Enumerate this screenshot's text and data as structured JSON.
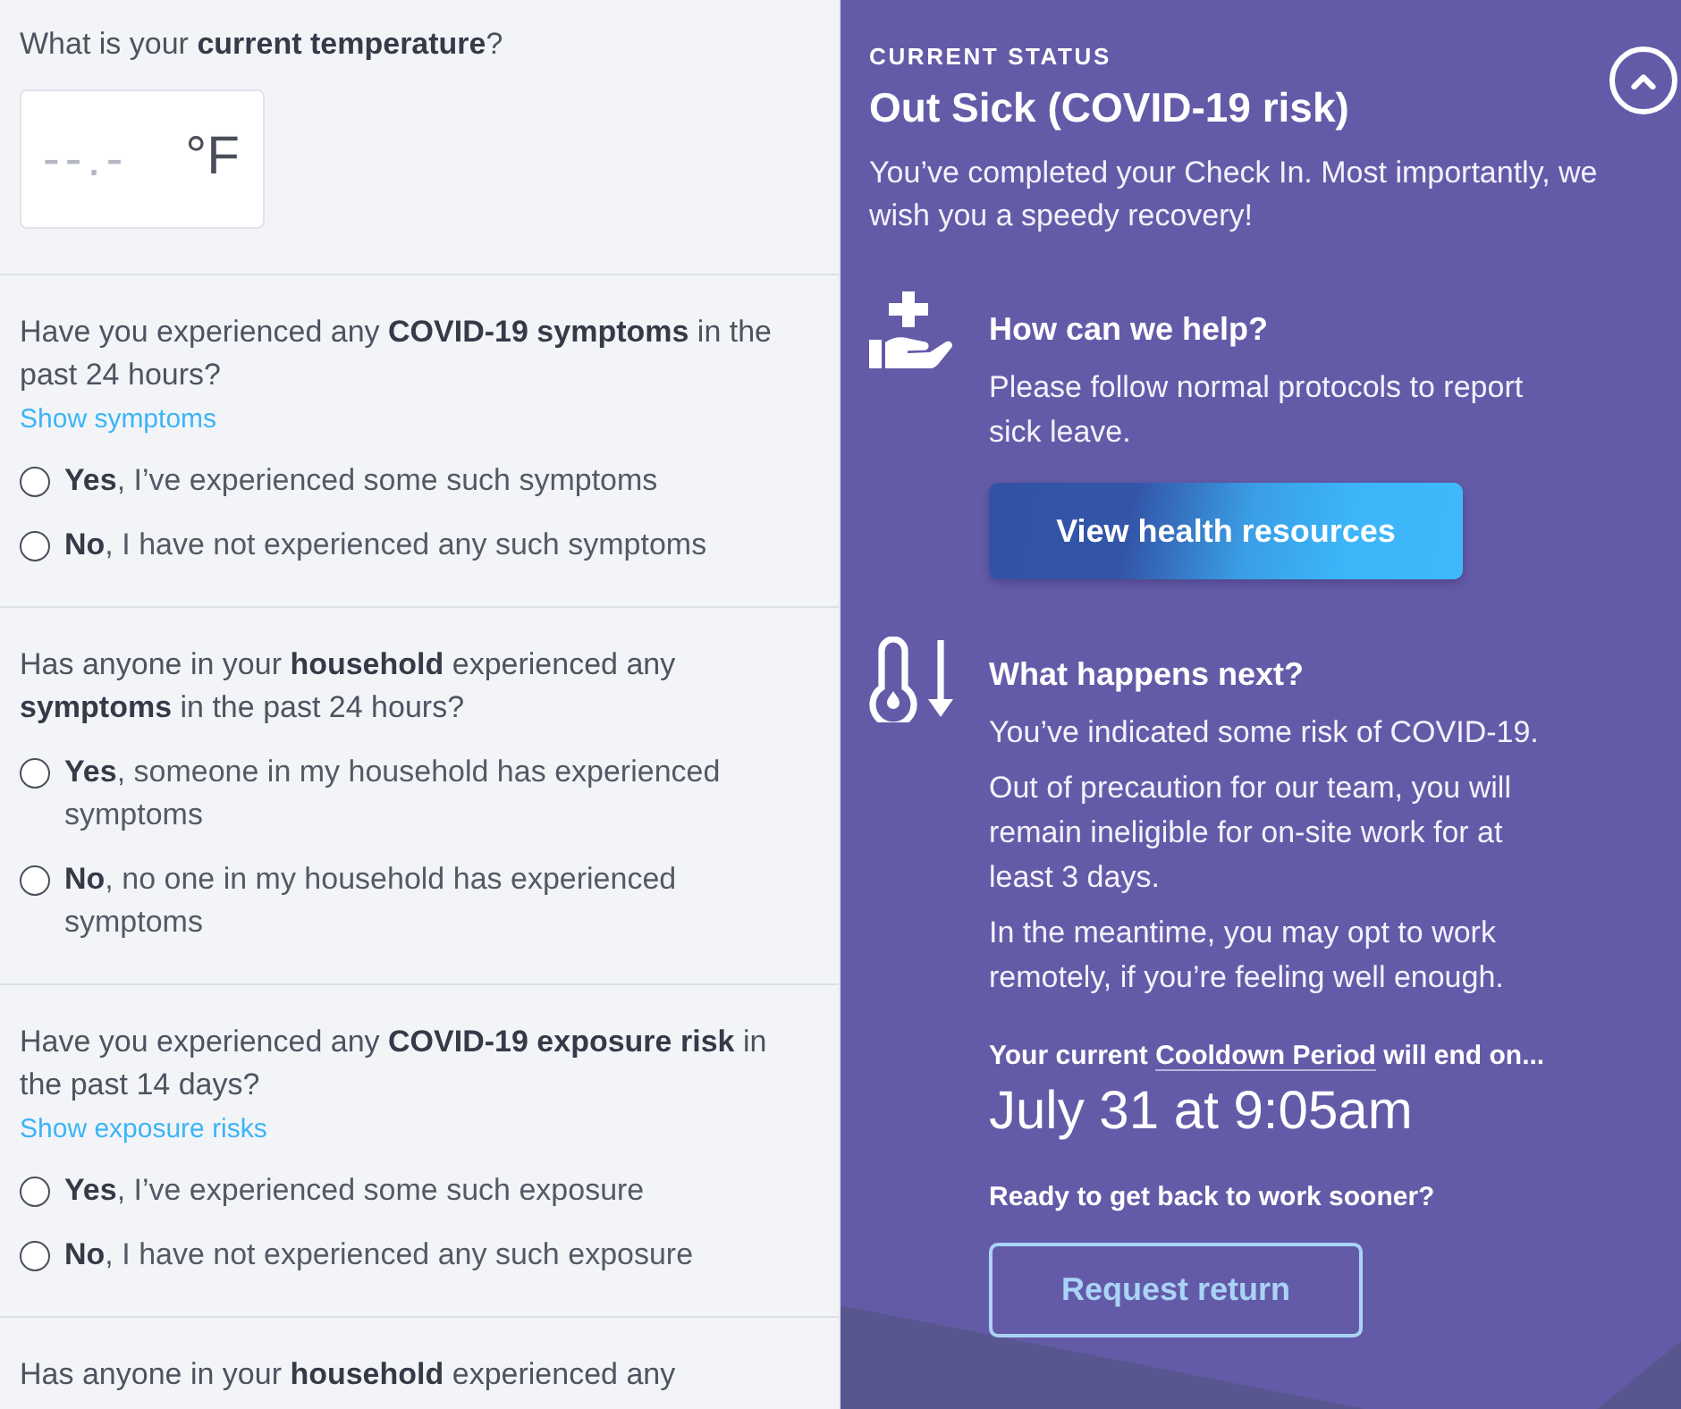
{
  "questions": [
    {
      "kind": "temperature",
      "text": "What is your **current temperature**?",
      "field": {
        "placeholder": "--.-",
        "unit": "°F"
      }
    },
    {
      "kind": "choice",
      "text": "Have you experienced any **COVID-19 symptoms** in the past 24 hours?",
      "link": "Show symptoms",
      "options": [
        {
          "text": "**Yes**, I’ve experienced some such symptoms",
          "selected": false
        },
        {
          "text": "**No**, I have not experienced any such symptoms",
          "selected": false
        }
      ]
    },
    {
      "kind": "choice",
      "text": "Has anyone in your **household** experienced any **symptoms** in the past 24 hours?",
      "options": [
        {
          "text": "**Yes**, someone in my household has experienced symptoms",
          "selected": false
        },
        {
          "text": "**No**, no one in my household has experienced symptoms",
          "selected": false
        }
      ]
    },
    {
      "kind": "choice",
      "text": "Have you experienced any **COVID-19 exposure risk** in the past 14 days?",
      "link": "Show exposure risks",
      "options": [
        {
          "text": "**Yes**, I’ve experienced some such exposure",
          "selected": false
        },
        {
          "text": "**No**, I have not experienced any such exposure",
          "selected": false
        }
      ]
    },
    {
      "kind": "choice",
      "text": "Has anyone in your **household** experienced any"
    }
  ],
  "status": {
    "label": "CURRENT STATUS",
    "title": "Out Sick (COVID-19 risk)",
    "message": "You’ve completed your Check In. Most importantly, we wish you a speedy recovery!"
  },
  "sections": [
    {
      "kind": "help",
      "heading": "How can we help?",
      "paragraphs": [
        "Please follow normal protocols to report sick leave."
      ],
      "button": "View health resources"
    },
    {
      "kind": "next",
      "heading": "What happens next?",
      "paragraphs": [
        "You’ve indicated some risk of COVID-19.",
        "Out of precaution for our team, you will remain ineligible for on-site work for at least 3 days.",
        "In the meantime, you may opt to work remotely, if you’re feeling well enough."
      ]
    }
  ],
  "cooldown": {
    "before": "Your current",
    "link": "Cooldown Period",
    "after": "will end on...",
    "end_time": "July 31 at 9:05am"
  },
  "return": {
    "prompt": "Ready to get back to work sooner?",
    "button": "Request return"
  }
}
